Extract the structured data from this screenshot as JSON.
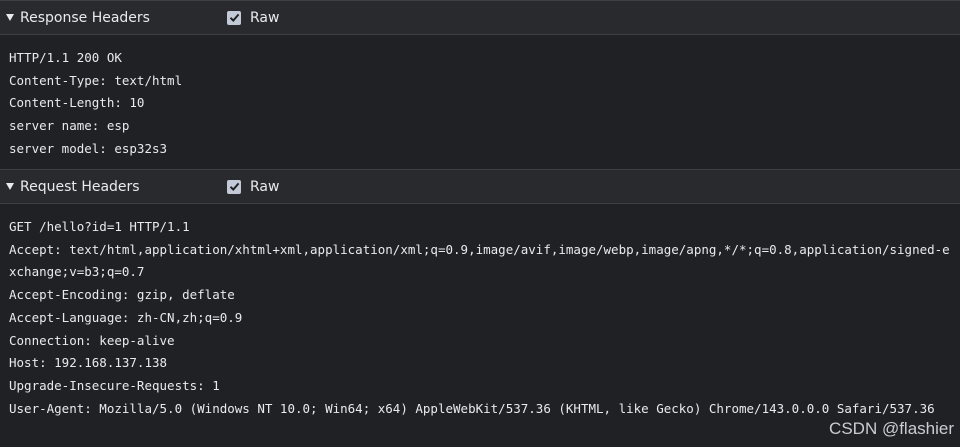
{
  "response_headers": {
    "title": "Response Headers",
    "raw_label": "Raw",
    "raw_checked": true,
    "lines": [
      "HTTP/1.1 200 OK",
      "Content-Type: text/html",
      "Content-Length: 10",
      "server name: esp",
      "server model: esp32s3"
    ]
  },
  "request_headers": {
    "title": "Request Headers",
    "raw_label": "Raw",
    "raw_checked": true,
    "lines": [
      "GET /hello?id=1 HTTP/1.1",
      "Accept: text/html,application/xhtml+xml,application/xml;q=0.9,image/avif,image/webp,image/apng,*/*;q=0.8,application/signed-exchange;v=b3;q=0.7",
      "Accept-Encoding: gzip, deflate",
      "Accept-Language: zh-CN,zh;q=0.9",
      "Connection: keep-alive",
      "Host: 192.168.137.138",
      "Upgrade-Insecure-Requests: 1",
      "User-Agent: Mozilla/5.0 (Windows NT 10.0; Win64; x64) AppleWebKit/537.36 (KHTML, like Gecko) Chrome/143.0.0.0 Safari/537.36"
    ]
  },
  "watermark": "CSDN @flashier",
  "icons": {
    "expand": "triangle-down-icon",
    "checkbox": "checkmark-icon"
  }
}
